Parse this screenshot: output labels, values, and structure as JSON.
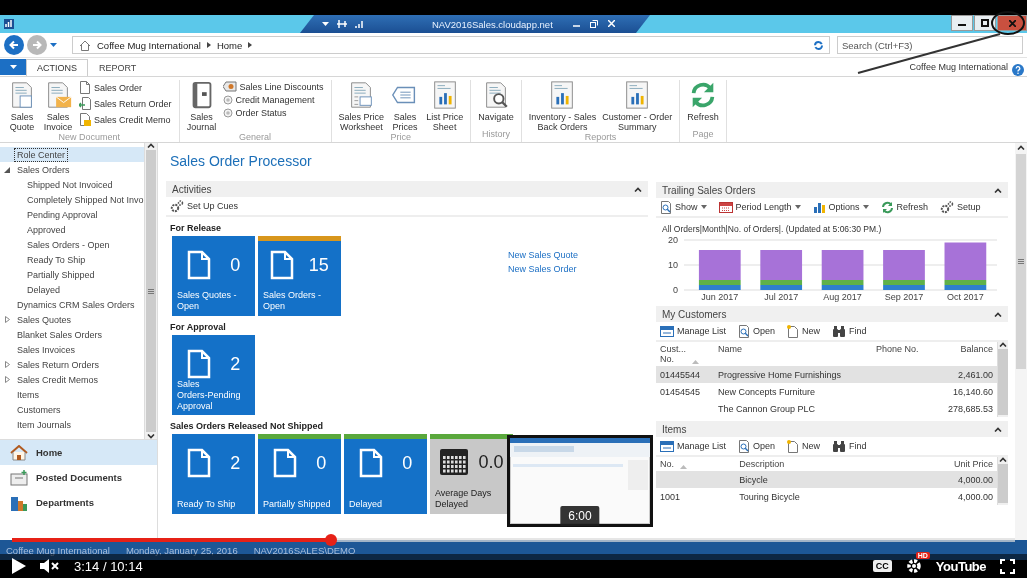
{
  "window": {
    "title": "NAV2016Sales.cloudapp.net"
  },
  "address_bar": {
    "breadcrumb": [
      "Coffee Mug International",
      "Home"
    ]
  },
  "search": {
    "placeholder": "Search (Ctrl+F3)"
  },
  "ribbon_tabs": [
    {
      "label": "ACTIONS",
      "selected": true
    },
    {
      "label": "REPORT",
      "selected": false
    }
  ],
  "company": "Coffee Mug International",
  "ribbon_groups": [
    {
      "name": "New Document",
      "large": [
        "Sales\nQuote",
        "Sales\nInvoice"
      ],
      "small": [
        "Sales Order",
        "Sales Return Order",
        "Sales Credit Memo"
      ]
    },
    {
      "name": "General",
      "large": [
        "Sales\nJournal"
      ],
      "small": [
        "Sales Line Discounts",
        "Credit Management",
        "Order Status"
      ]
    },
    {
      "name": "Price",
      "large": [
        "Sales Price\nWorksheet",
        "Sales\nPrices",
        "List Price\nSheet"
      ]
    },
    {
      "name": "History",
      "large": [
        "Navigate"
      ]
    },
    {
      "name": "Reports",
      "large": [
        "Inventory - Sales\nBack Orders",
        "Customer - Order\nSummary"
      ]
    },
    {
      "name": "Page",
      "large": [
        "Refresh"
      ]
    }
  ],
  "nav": {
    "tree": [
      {
        "label": "Role Center",
        "selected": true
      },
      {
        "label": "Sales Orders",
        "selected": false,
        "expanded": true,
        "children": [
          {
            "label": "Shipped Not Invoiced",
            "selected": false
          },
          {
            "label": "Completely Shipped Not Invo",
            "selected": false
          },
          {
            "label": "Pending Approval",
            "selected": false
          },
          {
            "label": "Approved",
            "selected": false
          },
          {
            "label": "Sales Orders - Open",
            "selected": false
          },
          {
            "label": "Ready To Ship",
            "selected": false
          },
          {
            "label": "Partially Shipped",
            "selected": false
          },
          {
            "label": "Delayed",
            "selected": false
          }
        ]
      },
      {
        "label": "Dynamics CRM Sales Orders",
        "selected": false
      },
      {
        "label": "Sales Quotes",
        "selected": false,
        "expanded": false
      },
      {
        "label": "Blanket Sales Orders",
        "selected": false
      },
      {
        "label": "Sales Invoices",
        "selected": false
      },
      {
        "label": "Sales Return Orders",
        "selected": false,
        "expanded": false
      },
      {
        "label": "Sales Credit Memos",
        "selected": false,
        "expanded": false
      },
      {
        "label": "Items",
        "selected": false
      },
      {
        "label": "Customers",
        "selected": false
      },
      {
        "label": "Item Journals",
        "selected": false
      }
    ],
    "sections": [
      {
        "label": "Home",
        "selected": true
      },
      {
        "label": "Posted Documents",
        "selected": false
      },
      {
        "label": "Departments",
        "selected": false
      }
    ]
  },
  "page_title": "Sales Order Processor",
  "activities": {
    "title": "Activities",
    "action": "Set Up Cues",
    "groups": [
      {
        "title": "For Release",
        "tiles": [
          {
            "kind": "count",
            "value": "0",
            "label": "Sales Quotes -\nOpen"
          },
          {
            "kind": "count",
            "value": "15",
            "label": "Sales Orders -\nOpen",
            "color": "#d8961c"
          }
        ],
        "links": [
          "New Sales Quote",
          "New Sales Order"
        ]
      },
      {
        "title": "For Approval",
        "tiles": [
          {
            "kind": "count",
            "value": "2",
            "label": "Sales\nOrders-Pending\nApproval"
          }
        ]
      },
      {
        "title": "Sales Orders Released Not Shipped",
        "tiles": [
          {
            "kind": "count",
            "value": "2",
            "label": "Ready To Ship"
          },
          {
            "kind": "count",
            "value": "0",
            "label": "Partially Shipped",
            "color": "#5aa83c"
          },
          {
            "kind": "count",
            "value": "0",
            "label": "Delayed",
            "color": "#5aa83c"
          },
          {
            "kind": "days",
            "value": "0.0",
            "label": "Average Days\nDelayed",
            "color": "#5aa83c"
          }
        ]
      }
    ]
  },
  "trailing": {
    "title": "Trailing Sales Orders",
    "actions": [
      {
        "label": "Show",
        "dropdown": true
      },
      {
        "label": "Period Length",
        "dropdown": true
      },
      {
        "label": "Options",
        "dropdown": true
      },
      {
        "label": "Refresh",
        "dropdown": false
      },
      {
        "label": "Setup",
        "dropdown": false
      }
    ],
    "chart_data": {
      "type": "bar",
      "title": "All Orders|Month|No. of Orders|. (Updated at  5:06:30 PM.)",
      "categories": [
        "Jun 2017",
        "Jul 2017",
        "Aug 2017",
        "Sep 2017",
        "Oct 2017"
      ],
      "stacked": true,
      "ylim": [
        0,
        20
      ],
      "yticks": [
        0,
        10,
        20
      ],
      "series": [
        {
          "color": "#2e7fd0",
          "values": [
            2,
            2,
            2,
            2,
            2
          ]
        },
        {
          "color": "#5fb14a",
          "values": [
            2,
            2,
            2,
            2,
            2
          ]
        },
        {
          "color": "#a772d8",
          "values": [
            12,
            12,
            12,
            12,
            15
          ]
        }
      ]
    }
  },
  "customers": {
    "title": "My Customers",
    "actions": [
      "Manage List",
      "Open",
      "New",
      "Find"
    ],
    "columns": [
      "Cust...\nNo.",
      "Name",
      "Phone No.",
      "Balance"
    ],
    "rows": [
      {
        "cells": [
          "01445544",
          "Progressive Home Furnishings",
          "",
          "2,461.00"
        ],
        "selected": true
      },
      {
        "cells": [
          "01454545",
          "New Concepts Furniture",
          "",
          "16,140.60"
        ],
        "selected": false
      },
      {
        "cells": [
          "",
          "The Cannon Group PLC",
          "",
          "278,685.53"
        ],
        "selected": false
      }
    ]
  },
  "items": {
    "title": "Items",
    "actions": [
      "Manage List",
      "Open",
      "New",
      "Find"
    ],
    "columns": [
      "No.",
      "Description",
      "Unit Price"
    ],
    "rows": [
      {
        "cells": [
          "",
          "Bicycle",
          "4,000.00"
        ],
        "selected": true
      },
      {
        "cells": [
          "1001",
          "Touring Bicycle",
          "4,000.00"
        ],
        "selected": false
      }
    ]
  },
  "status_bar": [
    "Coffee Mug International",
    "Monday, January 25, 2016",
    "NAV2016SALES\\DEMO"
  ],
  "video": {
    "time": "3:14 / 10:14",
    "preview_time": "6:00",
    "progress": {
      "level": 0.318
    },
    "cc": "CC",
    "hd": "HD",
    "logo": "YouTube"
  }
}
